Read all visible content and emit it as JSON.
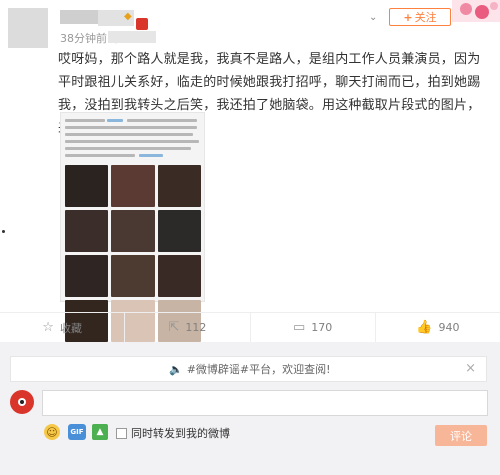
{
  "post": {
    "time_ago": "38分钟前",
    "source_prefix": "来",
    "vip_badge": "◆",
    "content": "哎呀妈，那个路人就是我，我真不是路人，是组内工作人员兼演员，因为平时跟祖儿关系好，临走的时候她跟我打招呼，聊天打闹而已，拍到她踢我，没拍到我转头之后笑，我还拍了她脑袋。用这种截取片段式的图片，来恶化人有意思么？"
  },
  "header": {
    "follow_plus": "+",
    "follow_label": "关注",
    "chevron": "⌄"
  },
  "actions": {
    "favorite_label": "收藏",
    "repost_count": "112",
    "comment_count": "170",
    "like_count": "940",
    "favorite_icon": "☆",
    "repost_icon": "⇱",
    "comment_icon": "▭",
    "like_icon": "👍"
  },
  "comment_box": {
    "notice_text": "#微博辟谣#平台，欢迎查阅!",
    "notice_close": "×",
    "forward_label": "同时转发到我的微博",
    "submit_label": "评论",
    "gif_label": "GIF"
  },
  "colors": {
    "accent": "#ff8140",
    "submit_bg": "#f7b697"
  },
  "thumb_colors": [
    "#2b2320",
    "#5a3a33",
    "#3a2b24",
    "#3b2d2a",
    "#4a3832",
    "#2c2a28",
    "#2f2623",
    "#4d3a30",
    "#3a2a26",
    "#32261f",
    "#d9c4b6",
    "#c8b4a4"
  ]
}
